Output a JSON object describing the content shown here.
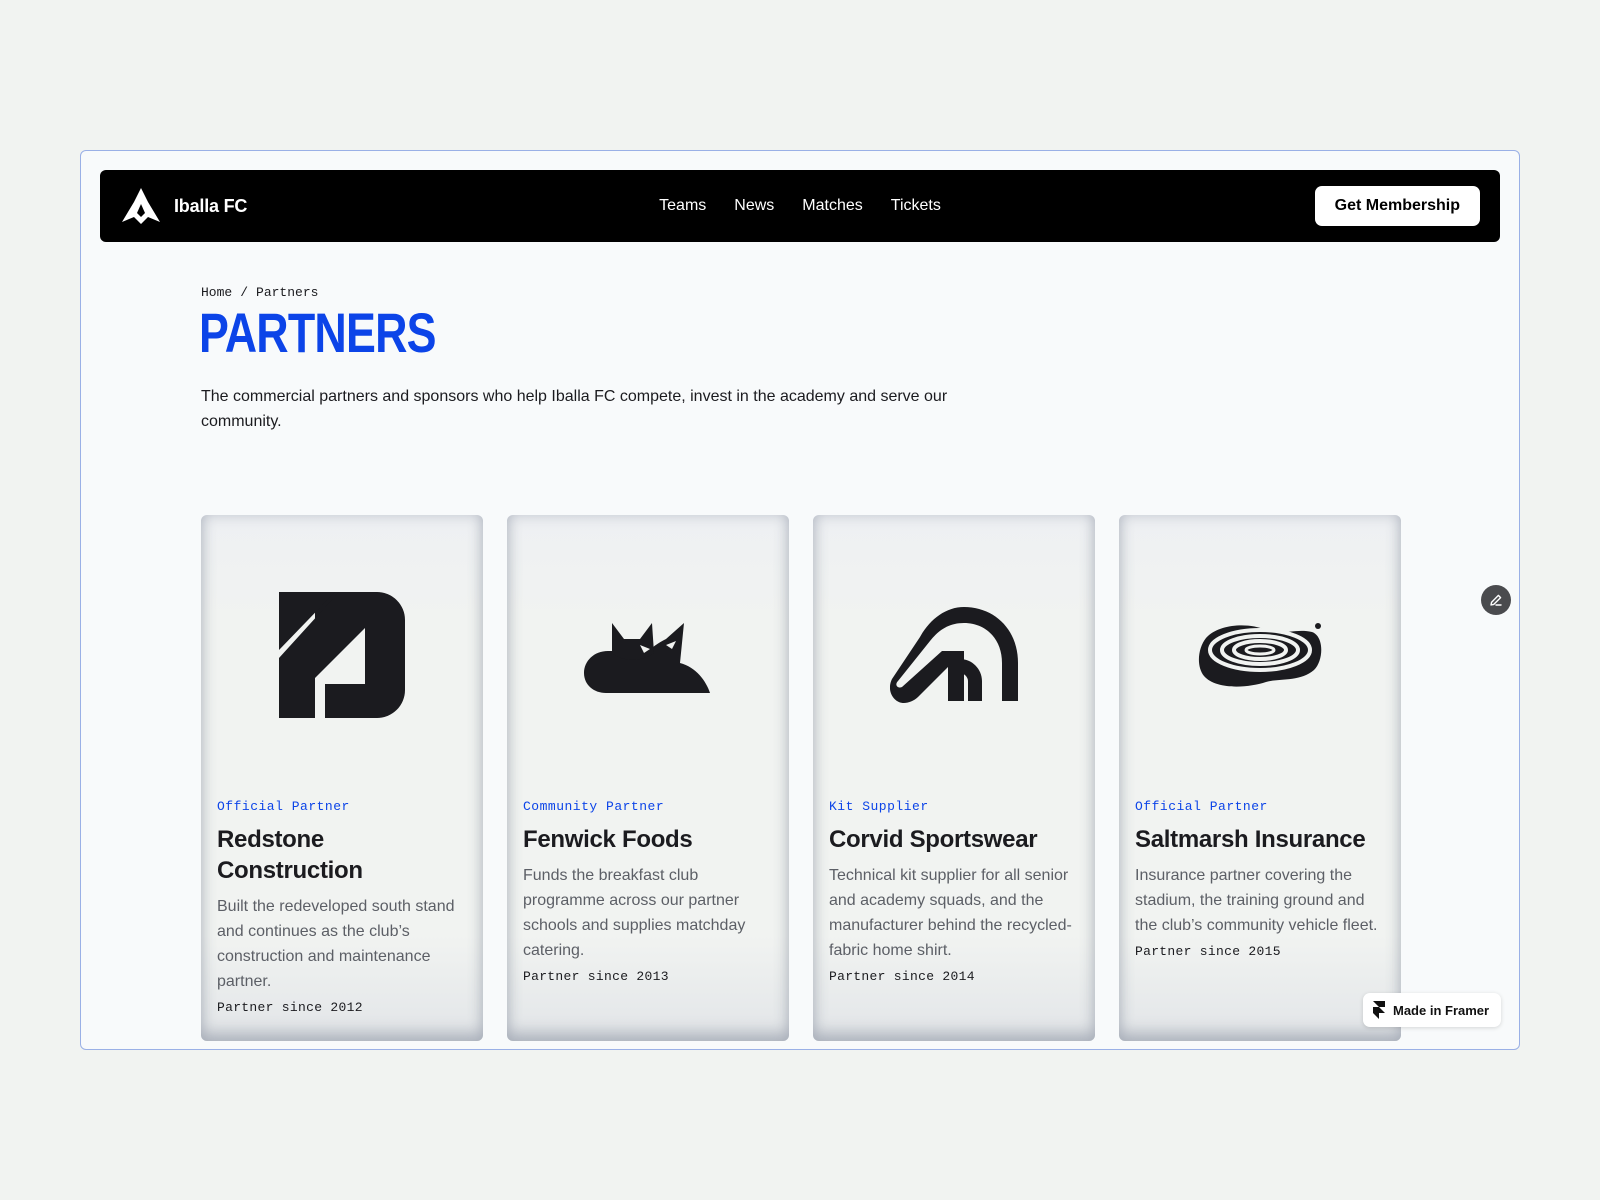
{
  "brand": {
    "name": "Iballa FC"
  },
  "nav": {
    "links": [
      "Teams",
      "News",
      "Matches",
      "Tickets"
    ],
    "cta_label": "Get Membership"
  },
  "breadcrumb": {
    "home": "Home",
    "separator": "/",
    "current": "Partners"
  },
  "page": {
    "title": "PARTNERS",
    "intro": "The commercial partners and sponsors who help Iballa FC compete, invest in the academy and serve our community."
  },
  "partners": [
    {
      "category": "Official Partner",
      "name": "Redstone Construction",
      "description": "Built the redeveloped south stand and continues as the club’s construction and maintenance partner.",
      "since": "Partner since 2012",
      "logo_icon": "redstone-logo-icon"
    },
    {
      "category": "Community Partner",
      "name": "Fenwick Foods",
      "description": "Funds the breakfast club programme across our partner schools and supplies matchday catering.",
      "since": "Partner since 2013",
      "logo_icon": "fox-logo-icon"
    },
    {
      "category": "Kit Supplier",
      "name": "Corvid Sportswear",
      "description": "Technical kit supplier for all senior and academy squads, and the manufacturer behind the recycled-fabric home shirt.",
      "since": "Partner since 2014",
      "logo_icon": "corvid-logo-icon"
    },
    {
      "category": "Official Partner",
      "name": "Saltmarsh Insurance",
      "description": "Insurance partner covering the stadium, the training ground and the club’s community vehicle fleet.",
      "since": "Partner since 2015",
      "logo_icon": "saltmarsh-logo-icon"
    }
  ],
  "framer_badge": {
    "label": "Made in Framer"
  },
  "colors": {
    "accent": "#0c44e8",
    "navbar": "#000000",
    "text": "#1b1b1f",
    "muted": "#5c5f66"
  }
}
